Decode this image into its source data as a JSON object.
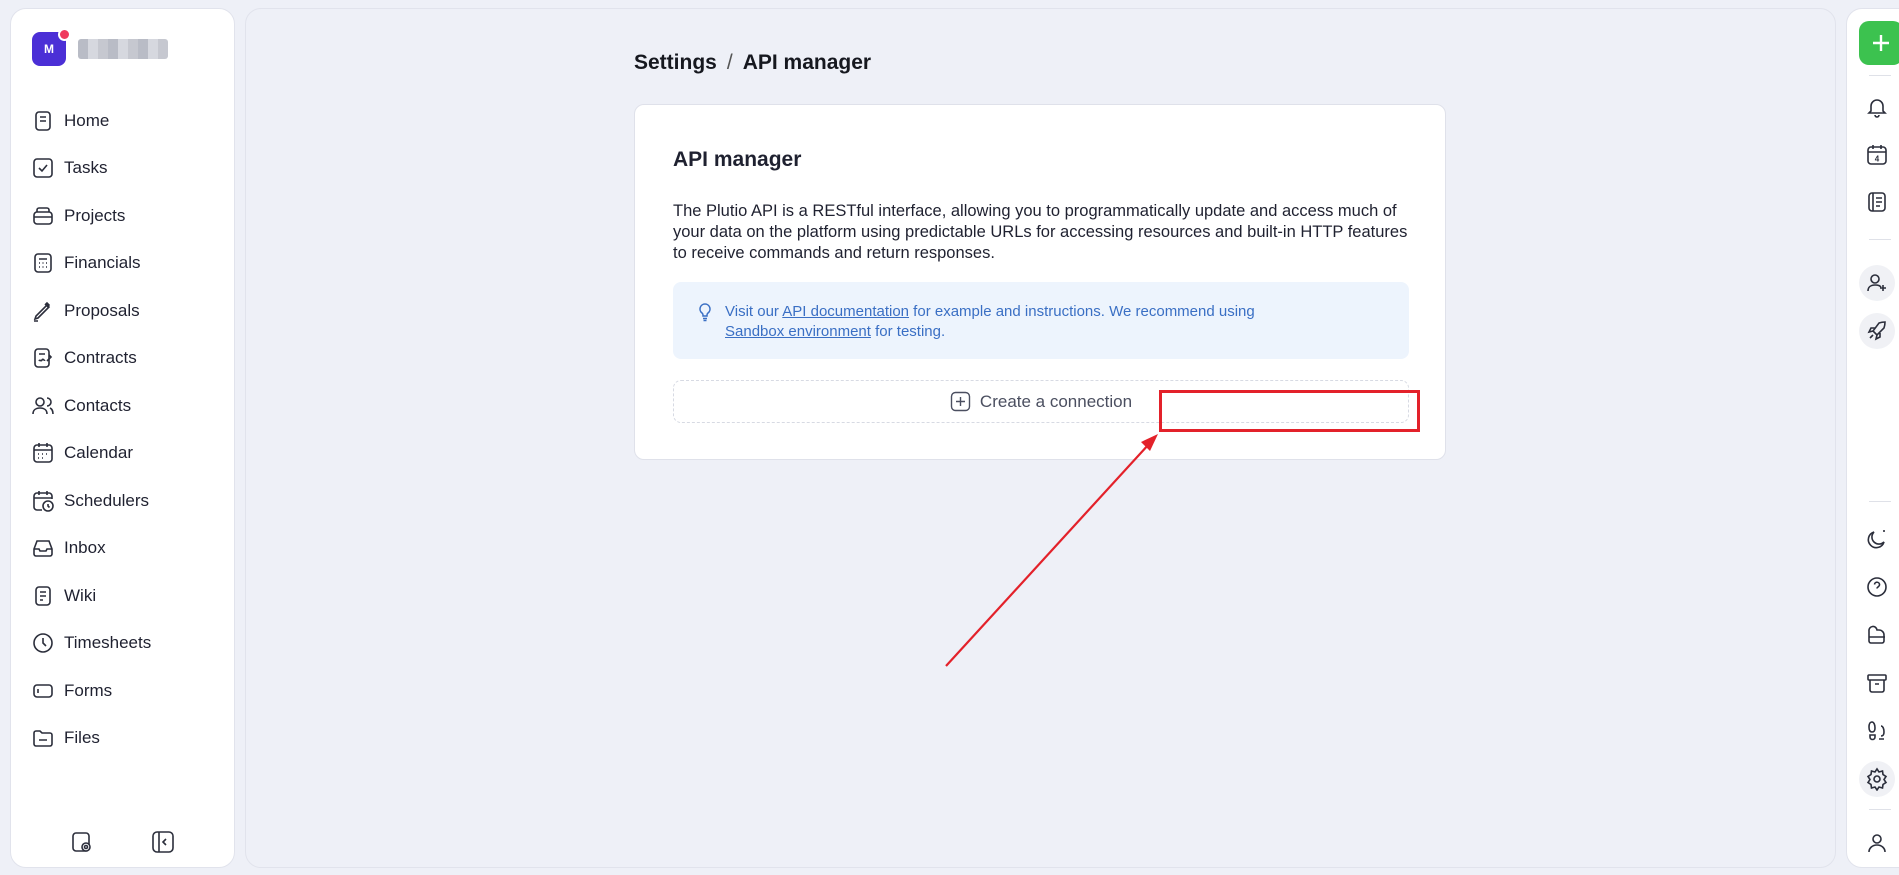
{
  "sidebar": {
    "avatar_initial": "M",
    "items": [
      {
        "label": "Home",
        "icon": "home-icon"
      },
      {
        "label": "Tasks",
        "icon": "tasks-icon"
      },
      {
        "label": "Projects",
        "icon": "projects-icon"
      },
      {
        "label": "Financials",
        "icon": "financials-icon"
      },
      {
        "label": "Proposals",
        "icon": "proposals-icon"
      },
      {
        "label": "Contracts",
        "icon": "contracts-icon"
      },
      {
        "label": "Contacts",
        "icon": "contacts-icon"
      },
      {
        "label": "Calendar",
        "icon": "calendar-icon"
      },
      {
        "label": "Schedulers",
        "icon": "schedulers-icon"
      },
      {
        "label": "Inbox",
        "icon": "inbox-icon"
      },
      {
        "label": "Wiki",
        "icon": "wiki-icon"
      },
      {
        "label": "Timesheets",
        "icon": "timesheets-icon"
      },
      {
        "label": "Forms",
        "icon": "forms-icon"
      },
      {
        "label": "Files",
        "icon": "files-icon"
      }
    ]
  },
  "breadcrumb": {
    "parent": "Settings",
    "separator": "/",
    "current": "API manager"
  },
  "card": {
    "title": "API manager",
    "description": "The Plutio API is a RESTful interface, allowing you to programmatically update and access much of your data on the platform using predictable URLs for accessing resources and built-in HTTP features to receive commands and return responses.",
    "hint": {
      "prefix": "Visit our ",
      "link1": "API documentation",
      "middle": " for example and instructions. We recommend using ",
      "link2": "Sandbox environment",
      "suffix": " for testing."
    },
    "create_label": "Create a connection"
  },
  "rail": {
    "calendar_day": "4"
  },
  "colors": {
    "accent_green": "#3cc24f",
    "avatar_purple": "#4b2fd6",
    "highlight_red": "#e3212a",
    "link_blue": "#3a6fc4"
  }
}
